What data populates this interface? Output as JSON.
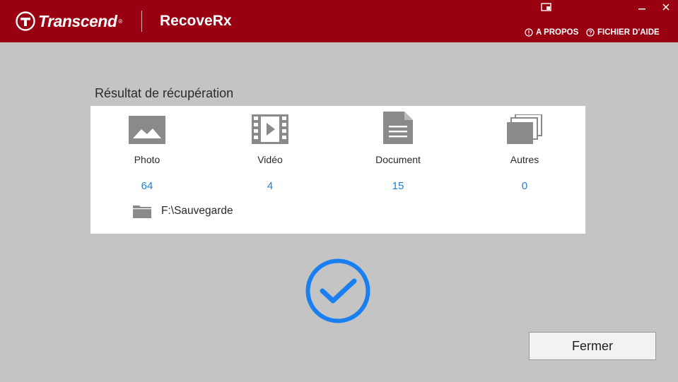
{
  "header": {
    "brand": "Transcend",
    "app_title": "RecoveRx",
    "about_label": "A PROPOS",
    "help_label": "FICHIER D'AIDE",
    "bg_color": "#990012"
  },
  "result": {
    "title": "Résultat de récupération",
    "categories": [
      {
        "icon": "photo-icon",
        "label": "Photo",
        "count": "64"
      },
      {
        "icon": "video-icon",
        "label": "Vidéo",
        "count": "4"
      },
      {
        "icon": "document-icon",
        "label": "Document",
        "count": "15"
      },
      {
        "icon": "others-icon",
        "label": "Autres",
        "count": "0"
      }
    ],
    "destination_path": "F:\\Sauvegarde"
  },
  "status": {
    "icon": "check-circle-icon",
    "color": "#1a7ff0"
  },
  "actions": {
    "close_label": "Fermer"
  }
}
